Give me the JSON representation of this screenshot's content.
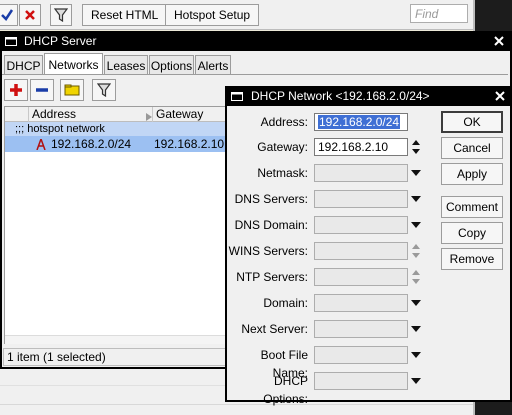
{
  "toolbar": {
    "reset_html": "Reset HTML",
    "hotspot_setup": "Hotspot Setup",
    "find_placeholder": "Find"
  },
  "dhcp_window": {
    "title": "DHCP Server",
    "tabs": [
      "DHCP",
      "Networks",
      "Leases",
      "Options",
      "Alerts"
    ],
    "active_tab": "Networks",
    "columns": [
      "Address",
      "Gateway"
    ],
    "group_label": ";;; hotspot network",
    "rows": [
      {
        "address": "192.168.2.0/24",
        "gateway": "192.168.2.10",
        "selected": true
      }
    ],
    "status": "1 item (1 selected)"
  },
  "dialog": {
    "title": "DHCP Network <192.168.2.0/24>",
    "fields": [
      {
        "label": "Address:",
        "value": "192.168.2.0/24"
      },
      {
        "label": "Gateway:",
        "value": "192.168.2.10"
      },
      {
        "label": "Netmask:",
        "value": ""
      },
      {
        "label": "DNS Servers:",
        "value": ""
      },
      {
        "label": "DNS Domain:",
        "value": ""
      },
      {
        "label": "WINS Servers:",
        "value": ""
      },
      {
        "label": "NTP Servers:",
        "value": ""
      },
      {
        "label": "Domain:",
        "value": ""
      },
      {
        "label": "Next Server:",
        "value": ""
      },
      {
        "label": "Boot File Name:",
        "value": ""
      },
      {
        "label": "DHCP Options:",
        "value": ""
      }
    ],
    "buttons": {
      "ok": "OK",
      "cancel": "Cancel",
      "apply": "Apply",
      "comment": "Comment",
      "copy": "Copy",
      "remove": "Remove"
    }
  },
  "colors": {
    "titlebar": "#000000",
    "selection": "#9cc0f2",
    "group_row": "#c1d6f5",
    "add_icon": "#d01010",
    "remove_icon": "#1a3da8",
    "folder_icon": "#f0d400"
  }
}
